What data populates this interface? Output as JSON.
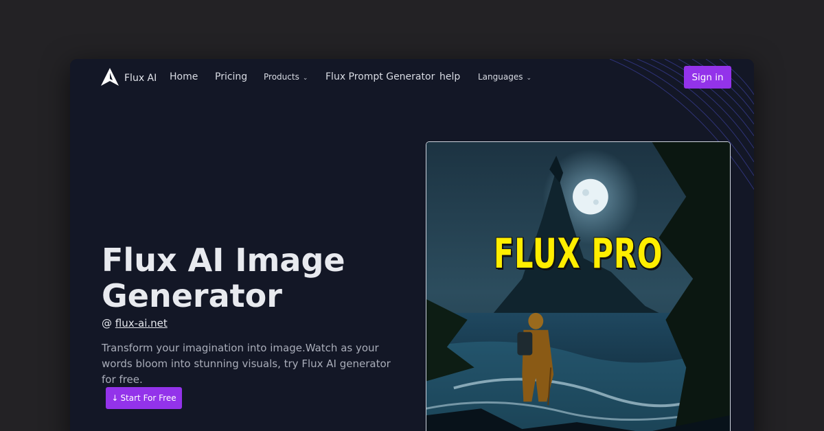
{
  "brand": {
    "name": "Flux AI",
    "logo_icon": "flux-logo-icon"
  },
  "nav": {
    "items": [
      {
        "label": "Home"
      },
      {
        "label": "Pricing"
      },
      {
        "label": "Products"
      },
      {
        "label": "Flux Prompt Generator"
      },
      {
        "label": "help"
      },
      {
        "label": "Languages"
      }
    ],
    "dropdown_icon": "chevron-down-icon",
    "sign_in": "Sign in"
  },
  "hero": {
    "title": "Flux AI Image Generator",
    "by_prefix": "@",
    "by_link": "flux-ai.net",
    "description": "Transform your imagination into image.Watch as your words bloom into stunning visuals, try Flux AI generator for free.",
    "cta_icon": "↓",
    "cta_label": "Start For Free",
    "image_text": "FLUX PRO"
  },
  "colors": {
    "background": "#232225",
    "panel": "#131726",
    "accent": "#9333ea",
    "poster_text": "#ffee00"
  }
}
